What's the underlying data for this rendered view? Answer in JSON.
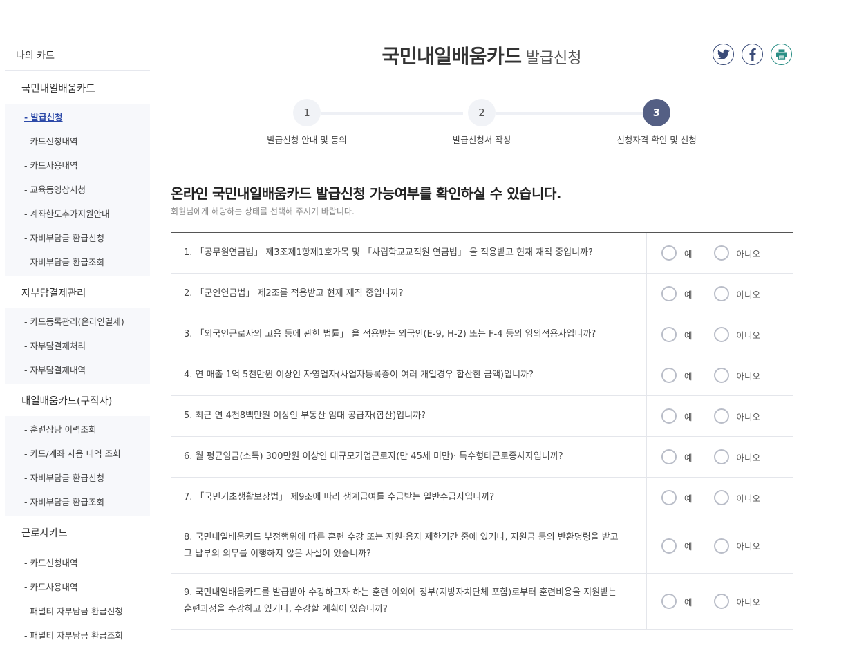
{
  "sidebar": {
    "top": "나의 카드",
    "groups": [
      {
        "title": "국민내일배움카드",
        "items": [
          "- 발급신청",
          "- 카드신청내역",
          "- 카드사용내역",
          "- 교육동영상시청",
          "- 계좌한도추가지원안내",
          "- 자비부담금 환급신청",
          "- 자비부담금 환급조회"
        ]
      },
      {
        "title": "자부담결제관리",
        "items": [
          "- 카드등록관리(온라인결제)",
          "- 자부담결제처리",
          "- 자부담결제내역"
        ]
      },
      {
        "title": "내일배움카드(구직자)",
        "items": [
          "- 훈련상담 이력조회",
          "- 카드/계좌 사용 내역 조회",
          "- 자비부담금 환급신청",
          "- 자비부담금 환급조회"
        ]
      },
      {
        "title": "근로자카드",
        "items": [
          "- 카드신청내역",
          "- 카드사용내역",
          "- 패널티 자부담금 환급신청",
          "- 패널티 자부담금 환급조회"
        ]
      }
    ]
  },
  "header": {
    "title": "국민내일배움카드",
    "subtitle": "발급신청",
    "share_icons": [
      "twitter-icon",
      "facebook-icon",
      "print-icon"
    ]
  },
  "steps": [
    {
      "num": "1",
      "label": "발급신청 안내 및 동의"
    },
    {
      "num": "2",
      "label": "발급신청서 작성"
    },
    {
      "num": "3",
      "label": "신청자격 확인 및 신청"
    }
  ],
  "headline": "온라인 국민내일배움카드 발급신청 가능여부를 확인하실 수 있습니다.",
  "subline": "회원님에게 해당하는 상태를 선택해 주시기 바랍니다.",
  "options": {
    "yes": "예",
    "no": "아니오"
  },
  "questions": [
    "1. 「공무원연금법」 제3조제1항제1호가목 및 「사립학교교직원 연금법」 을 적용받고 현재 재직 중입니까?",
    "2. 「군인연금법」 제2조를 적용받고 현재 재직 중입니까?",
    "3. 「외국인근로자의 고용 등에 관한 법률」 을 적용받는 외국인(E-9, H-2) 또는 F-4 등의 임의적용자입니까?",
    "4. 연 매출 1억 5천만원 이상인 자영업자(사업자등록증이 여러 개일경우 합산한 금액)입니까?",
    "5. 최근 연 4천8백만원 이상인 부동산 임대 공급자(합산)입니까?",
    "6. 월 평균임금(소득) 300만원 이상인 대규모기업근로자(만 45세 미만)· 특수형태근로종사자입니까?",
    "7. 「국민기초생활보장법」 제9조에 따라 생계급여를 수급받는 일반수급자입니까?",
    "8. 국민내일배움카드 부정행위에 따른 훈련 수강 또는 지원·융자 제한기간 중에 있거나, 지원금 등의 반환명령을 받고 그 납부의 의무를 이행하지 않은 사실이 있습니까?",
    "9. 국민내일배움카드를 발급받아 수강하고자 하는 훈련 이외에 정부(지방자치단체 포함)로부터 훈련비용을 지원받는 훈련과정을 수강하고 있거나, 수강할 계획이 있습니까?"
  ]
}
